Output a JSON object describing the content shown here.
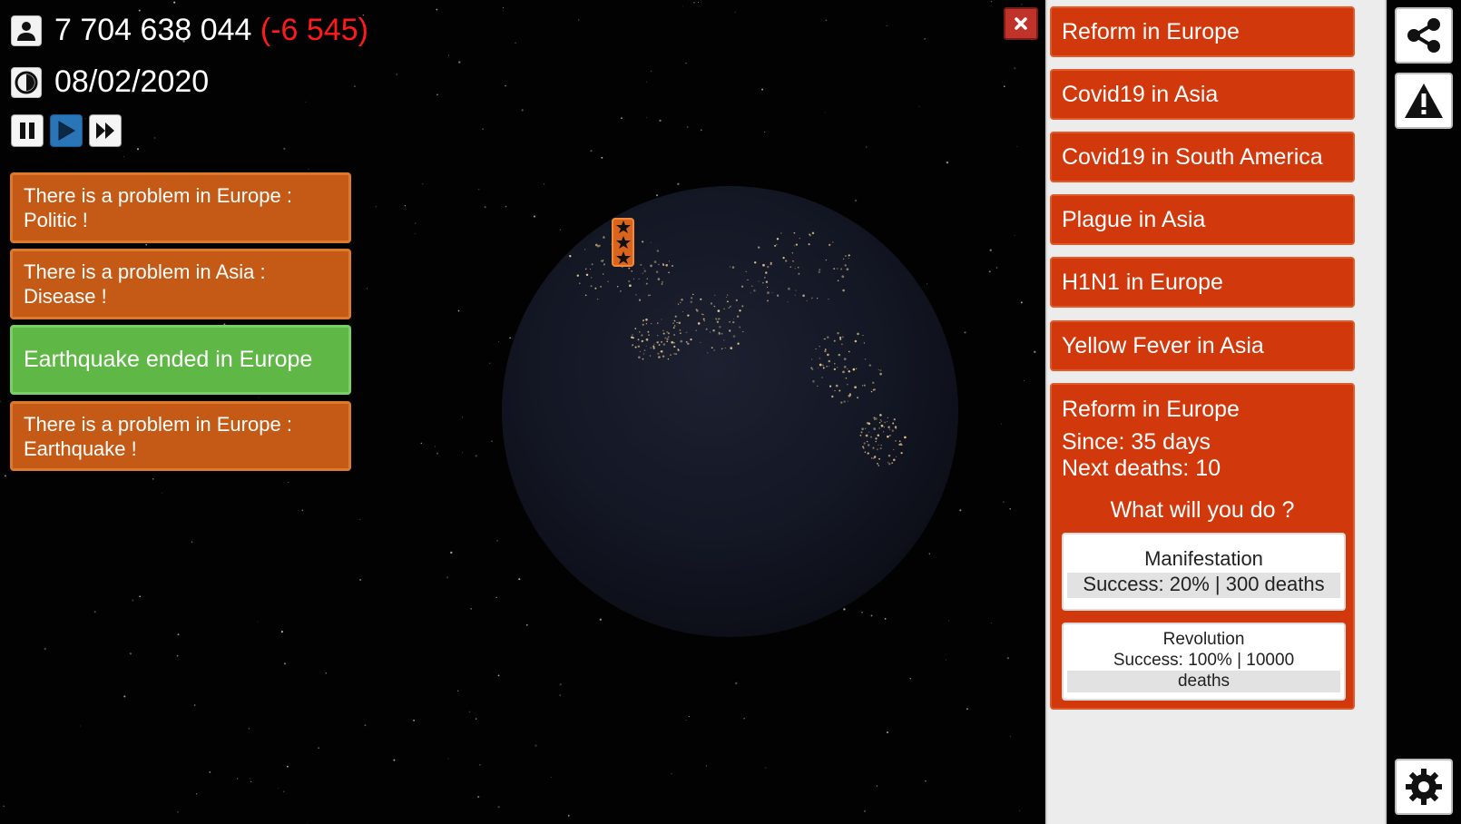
{
  "hud": {
    "population": "7 704 638 044",
    "population_delta": "(-6 545)",
    "date": "08/02/2020",
    "icons": {
      "population": "person-icon",
      "date": "clock-icon"
    }
  },
  "speed_controls": [
    {
      "name": "pause",
      "icon": "pause-icon",
      "active": false
    },
    {
      "name": "play",
      "icon": "play-icon",
      "active": true
    },
    {
      "name": "fast-forward",
      "icon": "fast-forward-icon",
      "active": false
    }
  ],
  "notifications": [
    {
      "lines": [
        "There is a problem in Europe :",
        "Politic !"
      ],
      "color": "orange"
    },
    {
      "lines": [
        "There is a problem in Asia :",
        "Disease !"
      ],
      "color": "orange"
    },
    {
      "lines": [
        "Earthquake ended in Europe"
      ],
      "color": "green"
    },
    {
      "lines": [
        "There is a problem in Europe :",
        "Earthquake !"
      ],
      "color": "orange"
    }
  ],
  "events": [
    "Reform in Europe",
    "Covid19 in Asia",
    "Covid19 in South America",
    "Plague in Asia",
    "H1N1 in Europe",
    "Yellow Fever in Asia"
  ],
  "selected_event": {
    "title": "Reform in Europe",
    "since": "Since: 35 days",
    "next_deaths": "Next deaths: 10",
    "question": "What will you do ?",
    "actions": [
      {
        "name": "Manifestation",
        "detail": "Success: 20% | 300 deaths"
      },
      {
        "name": "Revolution",
        "detail_lines": [
          "Success: 100% | 10000",
          "deaths"
        ]
      }
    ]
  },
  "side_buttons": [
    "share-icon",
    "warning-icon",
    "gear-icon"
  ],
  "colors": {
    "event_red": "#d1380c",
    "notif_orange": "#c45a16",
    "notif_green": "#5fb846",
    "delta_red": "#ff1b1b",
    "play_active": "#2a74b8"
  }
}
